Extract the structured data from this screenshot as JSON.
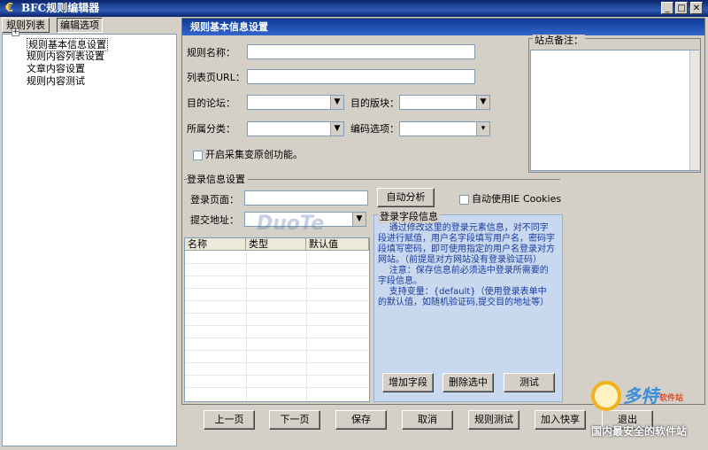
{
  "window": {
    "title": "BFC规则编辑器",
    "icon": "app-e-icon"
  },
  "left_tabs": [
    "规则列表",
    "编辑选项"
  ],
  "tree": {
    "items": [
      "规则基本信息设置",
      "规则内容列表设置",
      "文章内容设置",
      "规则内容测试"
    ],
    "expand_symbol": "+"
  },
  "panel": {
    "title": "规则基本信息设置"
  },
  "form": {
    "rule_name_label": "规则名称：",
    "list_url_label": "列表页URL：",
    "target_forum_label": "目的论坛：",
    "target_board_label": "目的版块：",
    "category_label": "所属分类：",
    "encoding_label": "编码选项：",
    "original_label": "开启采集变原创功能。"
  },
  "notes": {
    "label": "站点备注："
  },
  "login": {
    "group_label": "登录信息设置",
    "login_page_label": "登录页面：",
    "auto_analyze_button": "自动分析",
    "auto_ie_label": "自动使用IE",
    "cookies_label": "Cookies",
    "submit_address_label": "提交地址："
  },
  "grid": {
    "columns": [
      "名称",
      "类型",
      "默认值"
    ]
  },
  "info": {
    "title": "登录字段信息",
    "text": "    通过修改这里的登录元素信息，对不同字段进行赋值，用户名字段填写用户名，密码字段填写密码，即可使用指定的用户名登录对方网站。（前提是对方网站没有登录验证码）\n    注意：保存信息前必须选中登录所需要的字段信息。\n    支持变量：{default}（使用登录表单中的默认值，如随机验证码,提交目的地址等）",
    "add_button": "增加字段",
    "delete_button": "删除选中",
    "test_button": "测试"
  },
  "bottom_buttons": [
    "上一页",
    "下一页",
    "保存",
    "取消",
    "规则测试",
    "加入快享",
    "退出"
  ],
  "watermark": {
    "text": "DuoTe",
    "logo_name": "多特",
    "logo_sub": "软件站",
    "slogan": "国内最安全的软件站"
  }
}
